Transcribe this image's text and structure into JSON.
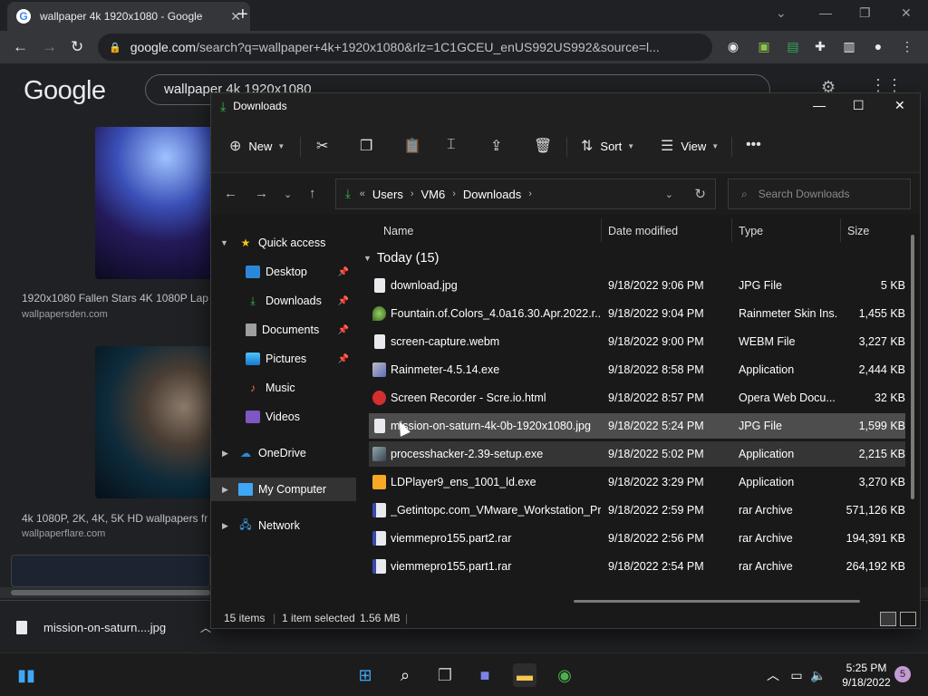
{
  "browser": {
    "tab_title": "wallpaper 4k 1920x1080 - Google",
    "url_host": "google.com",
    "url_rest": "/search?q=wallpaper+4k+1920x1080&rlz=1C1GCEU_enUS992US992&source=l..."
  },
  "google": {
    "logo": "Google",
    "query": "wallpaper 4k 1920x1080",
    "results": [
      {
        "title": "1920x1080 Fallen Stars 4K 1080P Lap",
        "site": "wallpapersden.com"
      },
      {
        "title": "4k 1080P, 2K, 4K, 5K HD wallpapers fr",
        "site": "wallpaperflare.com"
      }
    ]
  },
  "download_bar": {
    "item": "mission-on-saturn....jpg"
  },
  "explorer": {
    "title": "Downloads",
    "commands": {
      "new": "New",
      "sort": "Sort",
      "view": "View"
    },
    "breadcrumb": [
      "Users",
      "VM6",
      "Downloads"
    ],
    "search_placeholder": "Search Downloads",
    "nav": {
      "quick_access": "Quick access",
      "desktop": "Desktop",
      "downloads": "Downloads",
      "documents": "Documents",
      "pictures": "Pictures",
      "music": "Music",
      "videos": "Videos",
      "onedrive": "OneDrive",
      "my_computer": "My Computer",
      "network": "Network"
    },
    "columns": {
      "name": "Name",
      "date": "Date modified",
      "type": "Type",
      "size": "Size"
    },
    "group": "Today (15)",
    "files": [
      {
        "name": "download.jpg",
        "date": "9/18/2022 9:06 PM",
        "type": "JPG File",
        "size": "5 KB",
        "icon": "image-file-icon"
      },
      {
        "name": "Fountain.of.Colors_4.0a16.30.Apr.2022.r...",
        "date": "9/18/2022 9:04 PM",
        "type": "Rainmeter Skin Ins...",
        "size": "1,455 KB",
        "icon": "rainmeter-skin-icon"
      },
      {
        "name": "screen-capture.webm",
        "date": "9/18/2022 9:00 PM",
        "type": "WEBM File",
        "size": "3,227 KB",
        "icon": "video-file-icon"
      },
      {
        "name": "Rainmeter-4.5.14.exe",
        "date": "9/18/2022 8:58 PM",
        "type": "Application",
        "size": "2,444 KB",
        "icon": "installer-icon"
      },
      {
        "name": "Screen Recorder - Scre.io.html",
        "date": "9/18/2022 8:57 PM",
        "type": "Opera Web Docu...",
        "size": "32 KB",
        "icon": "opera-icon"
      },
      {
        "name": "mission-on-saturn-4k-0b-1920x1080.jpg",
        "date": "9/18/2022 5:24 PM",
        "type": "JPG File",
        "size": "1,599 KB",
        "icon": "image-file-icon"
      },
      {
        "name": "processhacker-2.39-setup.exe",
        "date": "9/18/2022 5:02 PM",
        "type": "Application",
        "size": "2,215 KB",
        "icon": "installer-icon"
      },
      {
        "name": "LDPlayer9_ens_1001_ld.exe",
        "date": "9/18/2022 3:29 PM",
        "type": "Application",
        "size": "3,270 KB",
        "icon": "ldplayer-icon"
      },
      {
        "name": "_Getintopc.com_VMware_Workstation_Pr...",
        "date": "9/18/2022 2:59 PM",
        "type": "rar Archive",
        "size": "571,126 KB",
        "icon": "rar-icon"
      },
      {
        "name": "viemmepro155.part2.rar",
        "date": "9/18/2022 2:56 PM",
        "type": "rar Archive",
        "size": "194,391 KB",
        "icon": "rar-icon"
      },
      {
        "name": "viemmepro155.part1.rar",
        "date": "9/18/2022 2:54 PM",
        "type": "rar Archive",
        "size": "264,192 KB",
        "icon": "rar-icon"
      }
    ],
    "status": {
      "count": "15 items",
      "selected": "1 item selected",
      "size": "1.56 MB"
    }
  },
  "taskbar": {
    "time": "5:25 PM",
    "date": "9/18/2022",
    "notifications": "5"
  },
  "colors": {
    "accent_green": "#3cba54",
    "selection": "#4d4d4d",
    "chrome_bg": "#202124"
  }
}
